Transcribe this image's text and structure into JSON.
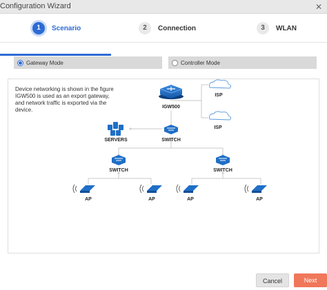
{
  "window": {
    "title": "Configuration Wizard",
    "close_icon": "close-icon"
  },
  "steps": [
    {
      "num": "1",
      "label": "Scenario",
      "active": true
    },
    {
      "num": "2",
      "label": "Connection",
      "active": false
    },
    {
      "num": "3",
      "label": "WLAN",
      "active": false
    }
  ],
  "modes": [
    {
      "label": "Gateway Mode",
      "checked": true
    },
    {
      "label": "Controller Mode",
      "checked": false
    }
  ],
  "panel": {
    "description": "Device networking is shown in the figure IGW500 is used as an export gateway, and network traffic is exported via the device."
  },
  "topology": {
    "gateway": "IGW500",
    "isp1": "ISP",
    "isp2": "ISP",
    "servers": "SERVERS",
    "core_switch": "SWITCH",
    "left_switch": "SWITCH",
    "right_switch": "SWITCH",
    "ap1": "AP",
    "ap2": "AP",
    "ap3": "AP",
    "ap4": "AP"
  },
  "buttons": {
    "cancel": "Cancel",
    "next": "Next"
  },
  "colors": {
    "accent": "#2d6bd4",
    "next_button": "#f0775a",
    "device": "#1f6fc7"
  }
}
